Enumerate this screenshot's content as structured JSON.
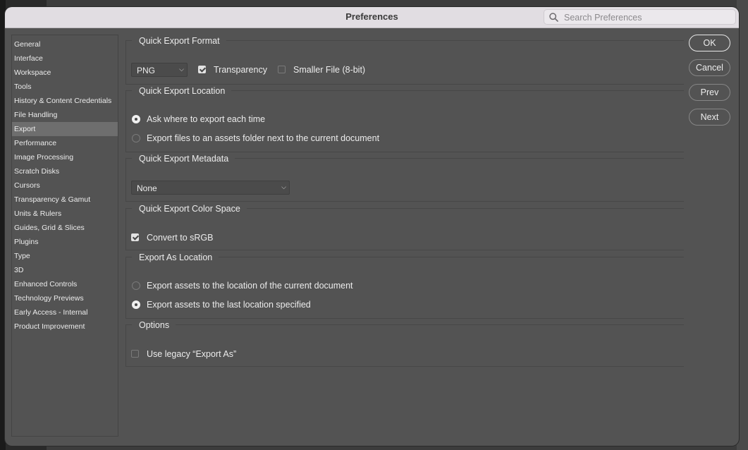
{
  "window": {
    "title": "Preferences",
    "search_placeholder": "Search Preferences"
  },
  "sidebar": {
    "items": [
      {
        "label": "General"
      },
      {
        "label": "Interface"
      },
      {
        "label": "Workspace"
      },
      {
        "label": "Tools"
      },
      {
        "label": "History & Content Credentials"
      },
      {
        "label": "File Handling"
      },
      {
        "label": "Export",
        "selected": true
      },
      {
        "label": "Performance"
      },
      {
        "label": "Image Processing"
      },
      {
        "label": "Scratch Disks"
      },
      {
        "label": "Cursors"
      },
      {
        "label": "Transparency & Gamut"
      },
      {
        "label": "Units & Rulers"
      },
      {
        "label": "Guides, Grid & Slices"
      },
      {
        "label": "Plugins"
      },
      {
        "label": "Type"
      },
      {
        "label": "3D"
      },
      {
        "label": "Enhanced Controls"
      },
      {
        "label": "Technology Previews"
      },
      {
        "label": "Early Access - Internal"
      },
      {
        "label": "Product Improvement"
      }
    ]
  },
  "format": {
    "title": "Quick Export Format",
    "select_value": "PNG",
    "transparency_label": "Transparency",
    "transparency_checked": true,
    "smaller_label": "Smaller File (8-bit)",
    "smaller_checked": false
  },
  "location": {
    "title": "Quick Export Location",
    "ask_label": "Ask where to export each time",
    "ask_selected": true,
    "assets_label": "Export files to an assets folder next to the current document",
    "assets_selected": false
  },
  "metadata": {
    "title": "Quick Export Metadata",
    "select_value": "None"
  },
  "colorspace": {
    "title": "Quick Export Color Space",
    "srgb_label": "Convert to sRGB",
    "srgb_checked": true
  },
  "exportas": {
    "title": "Export As Location",
    "current_label": "Export assets to the location of the current document",
    "current_selected": false,
    "last_label": "Export assets to the last location specified",
    "last_selected": true
  },
  "options": {
    "title": "Options",
    "legacy_label": "Use legacy “Export As”",
    "legacy_checked": false
  },
  "buttons": {
    "ok": "OK",
    "cancel": "Cancel",
    "prev": "Prev",
    "next": "Next"
  },
  "colors": {
    "panel_bg": "#535353",
    "titlebar_bg": "#e1dde2",
    "selected_item_bg": "#6e6e6e",
    "text": "#ececec"
  }
}
